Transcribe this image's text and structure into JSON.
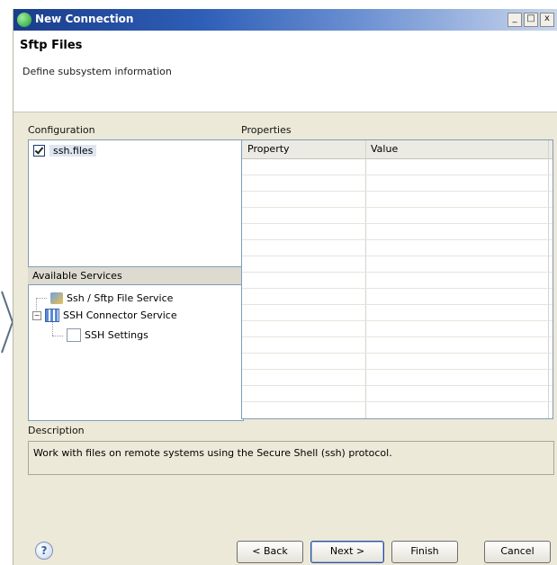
{
  "window": {
    "title": "New Connection",
    "buttons": [
      "_",
      "□",
      "x"
    ]
  },
  "header": {
    "title": "Sftp Files",
    "subtitle": "Define subsystem information"
  },
  "configuration": {
    "label": "Configuration",
    "items": [
      {
        "label": "ssh.files",
        "checked": true
      }
    ]
  },
  "properties": {
    "label": "Properties",
    "columns": [
      "Property",
      "Value"
    ],
    "rows": []
  },
  "available_services": {
    "label": "Available Services",
    "tree": [
      {
        "label": "Ssh / Sftp File Service",
        "icon": "sftp-service-icon"
      },
      {
        "label": "SSH Connector Service",
        "icon": "connector-service-icon",
        "expanded": true,
        "children": [
          {
            "label": "SSH Settings",
            "icon": "settings-icon"
          }
        ]
      }
    ]
  },
  "description": {
    "label": "Description",
    "text": "Work with files on remote systems using the Secure Shell (ssh) protocol."
  },
  "footer": {
    "help_icon": "?",
    "back": "< Back",
    "next": "Next >",
    "finish": "Finish",
    "cancel": "Cancel"
  }
}
